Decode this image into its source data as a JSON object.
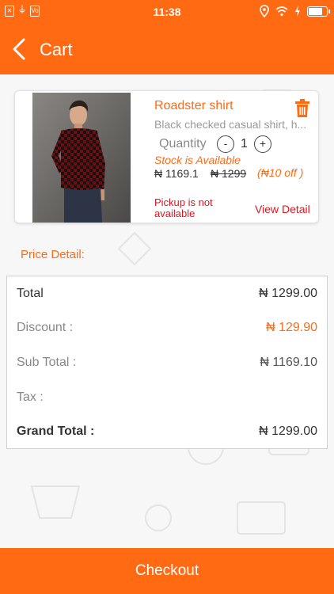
{
  "status_bar": {
    "time": "11:38",
    "battery_level": 0.8,
    "left_icons": [
      "x-icon",
      "usb-icon",
      "volte-icon"
    ],
    "right_icons": [
      "location-icon",
      "wifi-icon",
      "charging-icon",
      "battery-icon"
    ]
  },
  "app_bar": {
    "title": "Cart"
  },
  "cart_item": {
    "name": "Roadster shirt",
    "description": "Black checked casual shirt, h...",
    "quantity_label": "Quantity",
    "quantity": "1",
    "minus": "-",
    "plus": "+",
    "stock_status": "Stock is Available",
    "price": "₦ 1169.1",
    "original_price": "₦ 1299",
    "discount": "(₦10 off )",
    "pickup_status": "Pickup is not available",
    "view_detail": "View Detail"
  },
  "price_detail": {
    "heading": "Price Detail:",
    "rows": [
      {
        "label": "Total",
        "value": "₦ 1299.00"
      },
      {
        "label": "Discount :",
        "value": "₦ 129.90"
      },
      {
        "label": "Sub Total :",
        "value": "₦ 1169.10"
      },
      {
        "label": "Tax :",
        "value": ""
      },
      {
        "label": "Grand Total :",
        "value": "₦ 1299.00"
      }
    ]
  },
  "checkout_label": "Checkout",
  "colors": {
    "accent": "#ff6a13",
    "alert": "#e0141e",
    "background": "#f7f7f7"
  }
}
